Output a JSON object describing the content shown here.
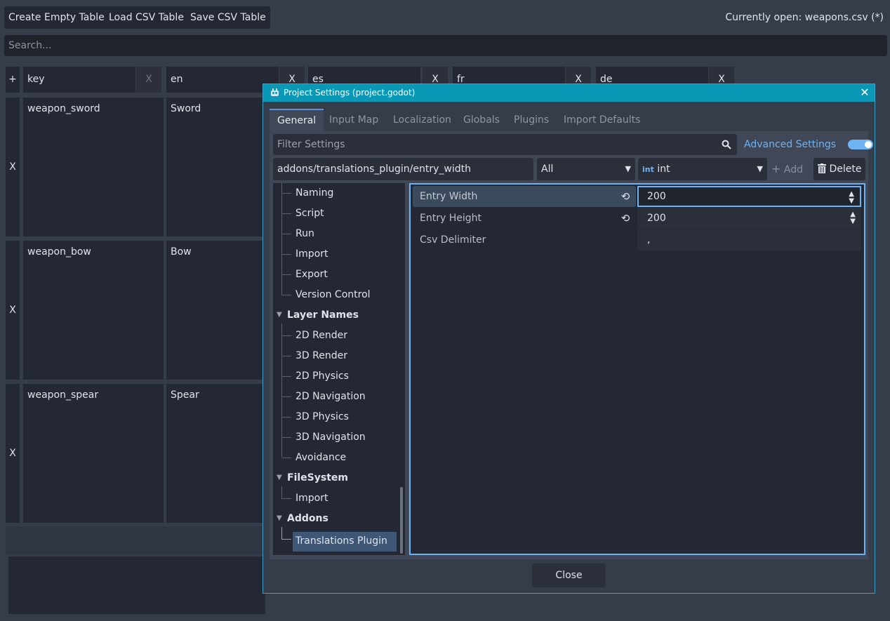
{
  "toolbar": {
    "create_label": "Create Empty Table",
    "load_label": "Load CSV Table",
    "save_label": "Save CSV Table",
    "currently_open": "Currently open: weapons.csv (*)"
  },
  "search": {
    "placeholder": "Search..."
  },
  "table": {
    "add_column": "+",
    "columns": [
      {
        "name": "key",
        "remove": "X"
      },
      {
        "name": "en",
        "remove": "X"
      },
      {
        "name": "es",
        "remove": "X"
      },
      {
        "name": "fr",
        "remove": "X"
      },
      {
        "name": "de",
        "remove": "X"
      }
    ],
    "rows": [
      {
        "remove": "X",
        "key": "weapon_sword",
        "en": "Sword"
      },
      {
        "remove": "X",
        "key": "weapon_bow",
        "en": "Bow"
      },
      {
        "remove": "X",
        "key": "weapon_spear",
        "en": "Spear"
      }
    ]
  },
  "dialog": {
    "title": "Project Settings (project.godot)",
    "close_glyph": "✕",
    "tabs": [
      "General",
      "Input Map",
      "Localization",
      "Globals",
      "Plugins",
      "Import Defaults"
    ],
    "filter_placeholder": "Filter Settings",
    "advanced_label": "Advanced Settings",
    "advanced_on": true,
    "path_value": "addons/translations_plugin/entry_width",
    "category_select": "All",
    "type_badge": "int",
    "type_select": "int",
    "add_label": "Add",
    "delete_label": "Delete",
    "tree": {
      "items_top": [
        "Naming",
        "Script",
        "Run",
        "Import",
        "Export",
        "Version Control"
      ],
      "layer_names": "Layer Names",
      "layer_items": [
        "2D Render",
        "3D Render",
        "2D Physics",
        "2D Navigation",
        "3D Physics",
        "3D Navigation",
        "Avoidance"
      ],
      "filesystem": "FileSystem",
      "fs_items": [
        "Import"
      ],
      "addons": "Addons",
      "addon_items": [
        "Translations Plugin"
      ]
    },
    "properties": [
      {
        "label": "Entry Width",
        "value": "200"
      },
      {
        "label": "Entry Height",
        "value": "200"
      },
      {
        "label": "Csv Delimiter",
        "value": ","
      }
    ],
    "close_label": "Close"
  }
}
